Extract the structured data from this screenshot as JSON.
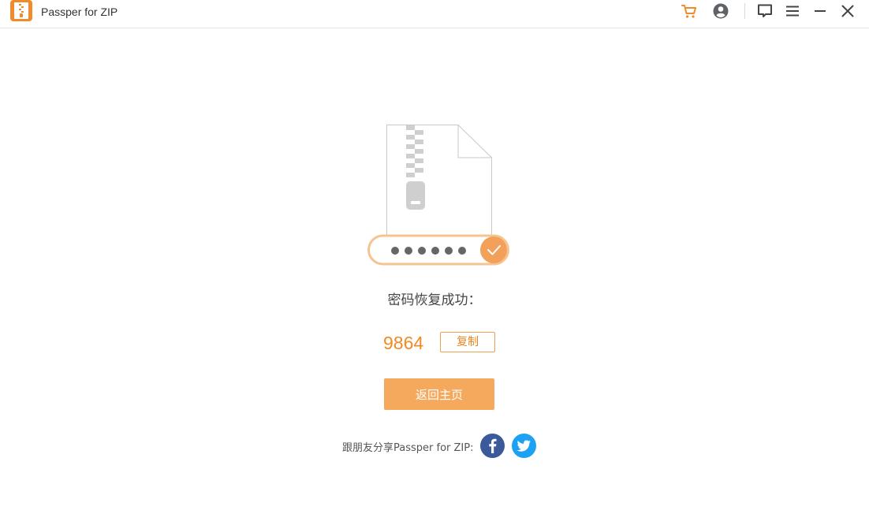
{
  "app": {
    "title": "Passper for ZIP"
  },
  "titlebar": {
    "icons": [
      "cart-icon",
      "account-icon",
      "feedback-icon",
      "menu-icon",
      "minimize-icon",
      "close-icon"
    ]
  },
  "illustration": {
    "masked_password": "●●●●●●"
  },
  "result": {
    "status_text": "密码恢复成功：",
    "password": "9864",
    "copy_label": "复制"
  },
  "home_button_label": "返回主页",
  "share": {
    "label": "跟朋友分享Passper for ZIP:",
    "networks": [
      "facebook-icon",
      "twitter-icon"
    ]
  },
  "colors": {
    "accent": "#f5a95c",
    "password_text": "#f28a23",
    "facebook": "#3b5a99",
    "twitter": "#1da1f2"
  }
}
